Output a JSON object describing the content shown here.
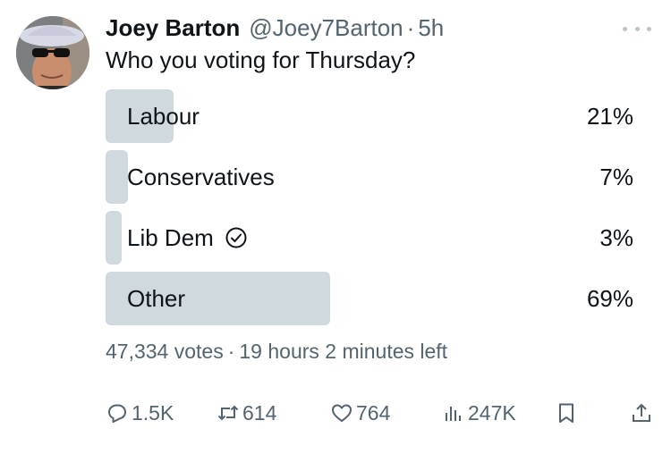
{
  "tweet": {
    "author_name": "Joey Barton",
    "handle": "@Joey7Barton",
    "separator": "·",
    "time": "5h",
    "text": "Who you voting for Thursday?"
  },
  "poll": {
    "options": [
      {
        "label": "Labour",
        "percent": "21%",
        "fraction": 0.21,
        "selected": false
      },
      {
        "label": "Conservatives",
        "percent": "7%",
        "fraction": 0.07,
        "selected": false
      },
      {
        "label": "Lib Dem",
        "percent": "3%",
        "fraction": 0.03,
        "selected": true
      },
      {
        "label": "Other",
        "percent": "69%",
        "fraction": 0.69,
        "selected": false
      }
    ],
    "votes": "47,334 votes",
    "meta_separator": "·",
    "time_left": "19 hours 2 minutes left"
  },
  "actions": {
    "replies": "1.5K",
    "retweets": "614",
    "likes": "764",
    "views": "247K"
  },
  "icons": {
    "more": "more-horizontal-icon",
    "reply": "reply-icon",
    "retweet": "retweet-icon",
    "like": "heart-icon",
    "views": "views-chart-icon",
    "bookmark": "bookmark-icon",
    "share": "share-icon",
    "selected": "check-circle-icon"
  },
  "colors": {
    "bar": "#cfd9de",
    "text": "#0f1419",
    "secondary": "#536471"
  }
}
